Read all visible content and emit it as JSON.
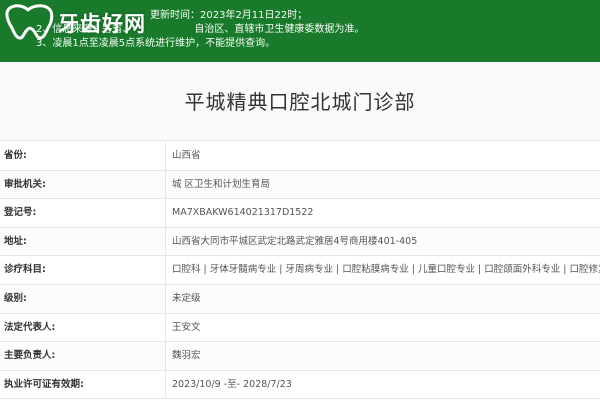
{
  "banner": {
    "logo_text": "牙齿好网",
    "line1": "更新时间：2023年2月11日22时；",
    "line2_head": "2、信息来源：各省、",
    "line2_tail": "自治区、直辖市卫生健康委数据为准。",
    "line3": "3、凌晨1点至凌晨5点系统进行维护，不能提供查询。",
    "colors": {
      "background": "#1a7a2c",
      "text": "#ffffff"
    }
  },
  "clinic": {
    "title": "平城精典口腔北城门诊部"
  },
  "fields": [
    {
      "label": "省份:",
      "value": "山西省"
    },
    {
      "label": "审批机关:",
      "value": "城 区卫生和计划生育局"
    },
    {
      "label": "登记号:",
      "value": "MA7XBAKW614021317D1522"
    },
    {
      "label": "地址:",
      "value": "山西省大同市平城区武定北路武定雅居4号商用楼401-405"
    },
    {
      "label": "诊疗科目:",
      "value": "口腔科 | 牙体牙髓病专业 | 牙周病专业 | 口腔粘膜病专业 | 儿童口腔专业 | 口腔颌面外科专业 | 口腔修复专业******"
    },
    {
      "label": "级别:",
      "value": "未定级"
    },
    {
      "label": "法定代表人:",
      "value": "王安文"
    },
    {
      "label": "主要负责人:",
      "value": "魏羽宏"
    },
    {
      "label": "执业许可证有效期:",
      "value": "2023/10/9 -至- 2028/7/23"
    }
  ]
}
